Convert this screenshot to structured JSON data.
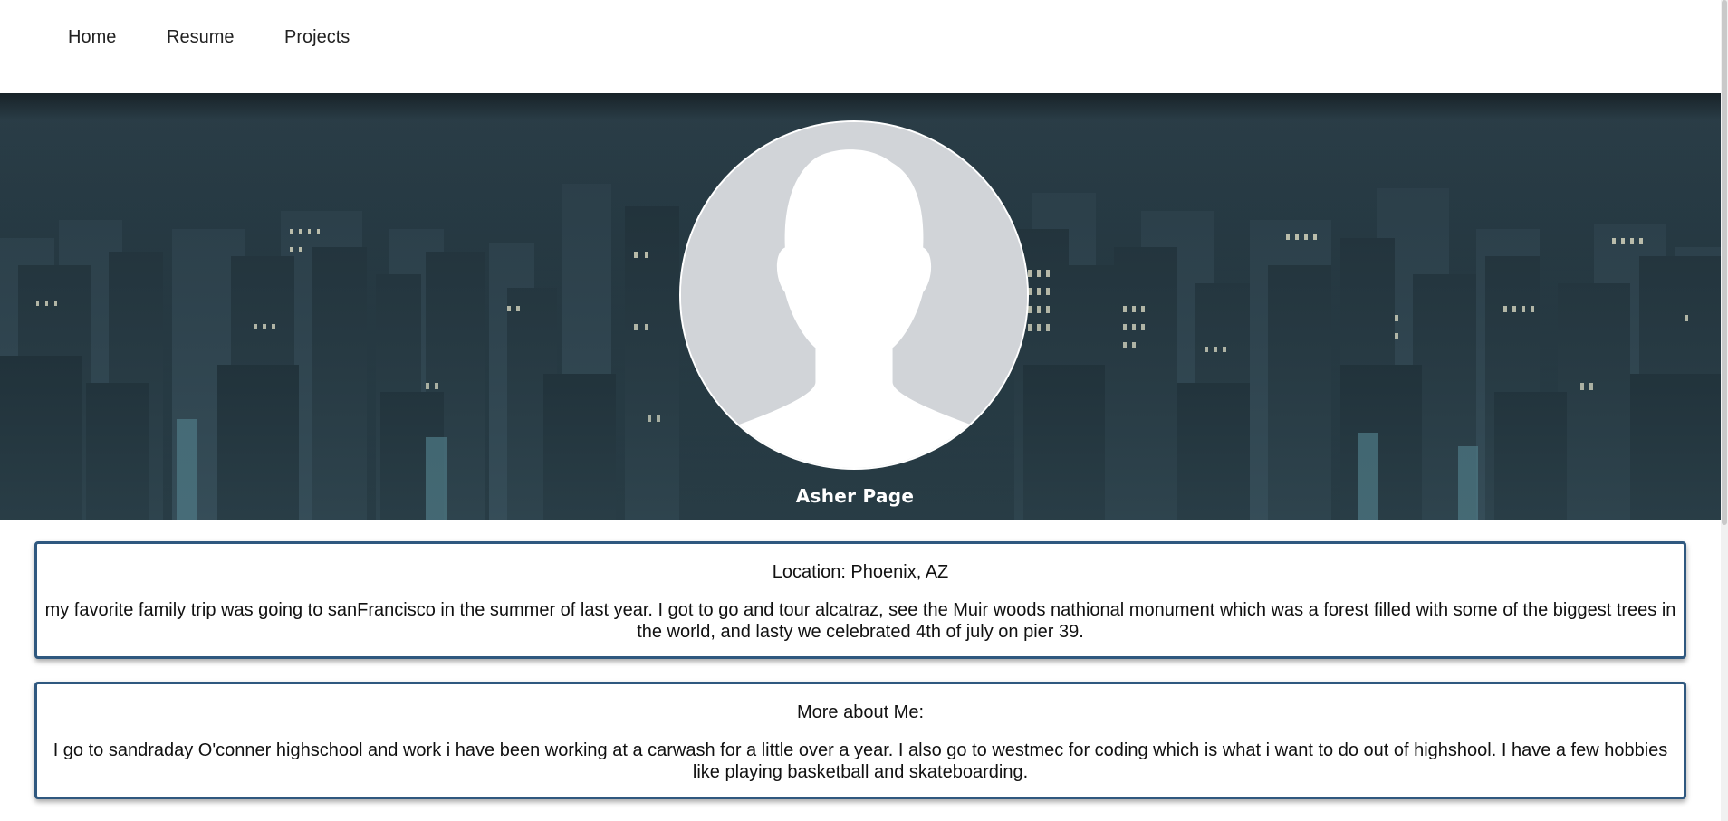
{
  "nav": {
    "items": [
      {
        "label": "Home"
      },
      {
        "label": "Resume"
      },
      {
        "label": "Projects"
      }
    ]
  },
  "hero": {
    "name": "Asher Page",
    "avatar_icon": "default-user-silhouette-icon",
    "background": "night-city-skyline"
  },
  "cards": {
    "location": {
      "title": "Location: Phoenix, AZ",
      "body": "my favorite family trip was going to sanFrancisco in the summer of last year. I got to go and tour alcatraz, see the Muir woods nathional monument which was a forest filled with some of the biggest trees in the world, and lasty we celebrated 4th of july on pier 39."
    },
    "about": {
      "title": "More about Me:",
      "body": "I go to sandraday O'conner highschool and work i have been working at a carwash for a little over a year. I also go to westmec for coding which is what i want to do out of highshool. I have a few hobbies like playing basketball and skateboarding."
    }
  },
  "colors": {
    "card_border": "#2f587f",
    "hero_dark": "#1c2c34",
    "avatar_bg": "#d1d4d8"
  }
}
